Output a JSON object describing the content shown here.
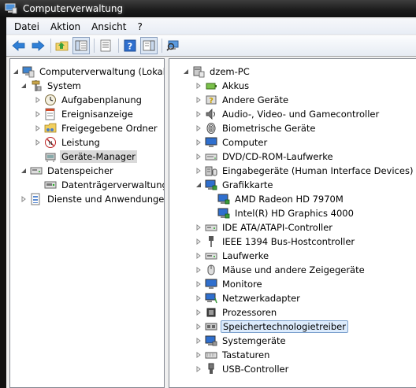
{
  "window": {
    "title": "Computerverwaltung"
  },
  "menu": [
    "Datei",
    "Aktion",
    "Ansicht",
    "?"
  ],
  "toolbar": [
    "back-icon",
    "forward-icon",
    "up-folder-icon",
    "show-hide-tree-icon",
    "properties-icon",
    "help-icon",
    "show-hide-action-pane-icon",
    "scan-hardware-icon"
  ],
  "left_tree": {
    "root": "Computerverwaltung (Lokal)",
    "system": "System",
    "aufgabenplanung": "Aufgabenplanung",
    "ereignisanzeige": "Ereignisanzeige",
    "freigegebene": "Freigegebene Ordner",
    "leistung": "Leistung",
    "geraete_manager": "Geräte-Manager",
    "datenspeicher": "Datenspeicher",
    "datentraeger": "Datenträgerverwaltung",
    "dienste": "Dienste und Anwendungen"
  },
  "device_tree": {
    "root": "dzem-PC",
    "akkus": "Akkus",
    "andere": "Andere Geräte",
    "audio": "Audio-, Video- und Gamecontroller",
    "bio": "Biometrische Geräte",
    "computer": "Computer",
    "dvd": "DVD/CD-ROM-Laufwerke",
    "hid": "Eingabegeräte (Human Interface Devices)",
    "grafik": "Grafikkarte",
    "amd": "AMD Radeon HD 7970M",
    "intel": "Intel(R) HD Graphics 4000",
    "ide": "IDE ATA/ATAPI-Controller",
    "ieee": "IEEE 1394 Bus-Hostcontroller",
    "laufwerke": "Laufwerke",
    "maeuse": "Mäuse und andere Zeigegeräte",
    "monitore": "Monitore",
    "netzwerk": "Netzwerkadapter",
    "prozessoren": "Prozessoren",
    "speicher": "Speichertechnologietreiber",
    "system": "Systemgeräte",
    "tastaturen": "Tastaturen",
    "usb": "USB-Controller"
  }
}
